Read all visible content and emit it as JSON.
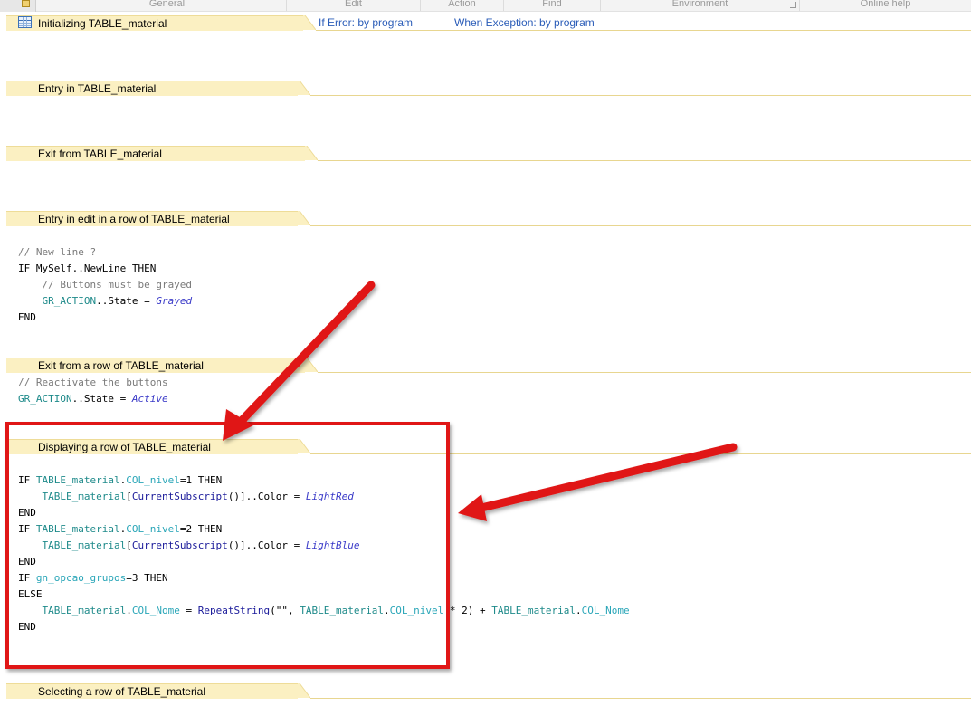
{
  "ribbon": {
    "groups": [
      "General",
      "Edit",
      "Action",
      "Find",
      "Environment",
      "Online help"
    ]
  },
  "header": {
    "error_link": "If Error: by program",
    "exception_link": "When Exception: by program"
  },
  "sections": {
    "initializing": "Initializing TABLE_material",
    "entry": "Entry in TABLE_material",
    "exit": "Exit from TABLE_material",
    "entry_edit_row": "Entry in edit in a row of TABLE_material",
    "exit_row": "Exit from a row of TABLE_material",
    "displaying_row": "Displaying a row of TABLE_material",
    "selecting_row": "Selecting a row of TABLE_material"
  },
  "code": {
    "entry_edit_row": [
      "// New line ?",
      "IF MySelf..NewLine THEN",
      "    // Buttons must be grayed",
      "    GR_ACTION..State = Grayed",
      "END"
    ],
    "exit_row": [
      "// Reactivate the buttons",
      "GR_ACTION..State = Active"
    ],
    "displaying_row": [
      "IF TABLE_material.COL_nivel=1 THEN",
      "    TABLE_material[CurrentSubscript()]..Color = LightRed",
      "END",
      "IF TABLE_material.COL_nivel=2 THEN",
      "    TABLE_material[CurrentSubscript()]..Color = LightBlue",
      "END",
      "IF gn_opcao_grupos=3 THEN",
      "ELSE",
      "    TABLE_material.COL_Nome = RepeatString(\"\", TABLE_material.COL_nivel * 2) + TABLE_material.COL_Nome",
      "END"
    ]
  },
  "colors": {
    "section_tab": "#fbf0c2",
    "section_rule": "#e8d690",
    "link": "#2a5cb8",
    "highlight": "#e01616",
    "code_object": "#1e8a8a",
    "code_column": "#2aa6b8",
    "code_constant": "#3a3ac8"
  },
  "icons": {
    "table": "table-icon",
    "annotation_arrows": "arrow-icon"
  }
}
